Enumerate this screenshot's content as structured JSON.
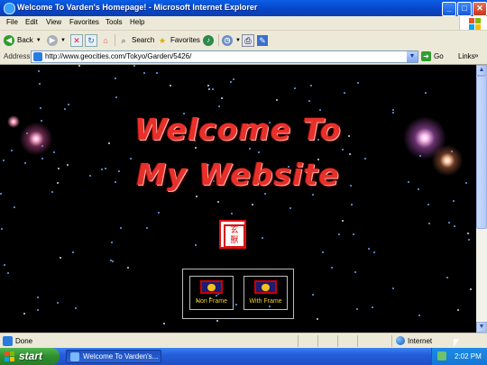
{
  "window": {
    "title": "Welcome To Varden's Homepage! - Microsoft Internet Explorer",
    "minimize": "_",
    "maximize": "□",
    "close": "✕"
  },
  "menu": [
    "File",
    "Edit",
    "View",
    "Favorites",
    "Tools",
    "Help"
  ],
  "toolbar": {
    "back": "Back",
    "search": "Search",
    "favorites": "Favorites"
  },
  "address": {
    "label": "Address",
    "url": "http://www.geocities.com/Tokyo/Garden/5426/",
    "go": "Go",
    "links": "Links",
    "links_chevron": "»"
  },
  "page": {
    "headline_line1": "Welcome To",
    "headline_line2": "My Website",
    "stamp_glyphs": "玄\n獸",
    "nav": [
      {
        "label": "Non Frame"
      },
      {
        "label": "With Frame"
      }
    ]
  },
  "status": {
    "text": "Done",
    "zone": "Internet"
  },
  "taskbar": {
    "start": "start",
    "task_label": "Welcome To Varden's...",
    "clock": "2:02 PM"
  },
  "colors": {
    "headline": "#e8302a",
    "nav_label": "#f2d21f",
    "title_bar": "#0a5fe6",
    "start_button": "#3fa33f"
  }
}
